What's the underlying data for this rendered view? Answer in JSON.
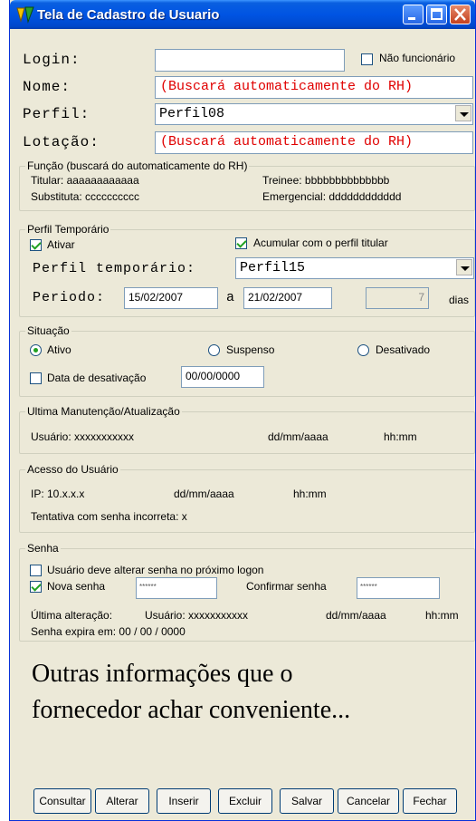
{
  "window": {
    "title": "Tela de Cadastro de Usuario",
    "icon": "app-logo-icon"
  },
  "colors": {
    "titlebar": "#0054e3",
    "face": "#ece9d8",
    "error_text": "#e00000",
    "check": "#21a121"
  },
  "header": {
    "login_label": "Login:",
    "login_value": "",
    "nao_funcionario_label": "Não funcionário",
    "nome_label": "Nome:",
    "nome_value": "(Buscará automaticamente do RH)",
    "perfil_label": "Perfil:",
    "perfil_value": "Perfil08",
    "lotacao_label": "Lotação:",
    "lotacao_value": "(Buscará automaticamente do RH)"
  },
  "funcao": {
    "legend": "Função (buscará do automaticamente do RH)",
    "titular": "Titular:  aaaaaaaaaaaa",
    "trainee": "Treinee:  bbbbbbbbbbbbbb",
    "substituta": "Substituta:  cccccccccc",
    "emergencial": "Emergencial:  dddddddddddd"
  },
  "perfil_temporario": {
    "legend": "Perfil Temporário",
    "ativar_label": "Ativar",
    "acumular_label": "Acumular com o perfil titular",
    "perfil_label": "Perfil temporário:",
    "perfil_value": "Perfil15",
    "periodo_label": "Periodo:",
    "data_inicio": "15/02/2007",
    "a_label": "a",
    "data_fim": "21/02/2007",
    "dias_value": "7",
    "dias_label": "dias"
  },
  "situacao": {
    "legend": "Situação",
    "ativo_label": "Ativo",
    "suspenso_label": "Suspenso",
    "desativado_label": "Desativado",
    "data_desativacao_label": "Data de desativação",
    "data_desativacao_value": "00/00/0000"
  },
  "manutencao": {
    "legend": "Ultima Manutenção/Atualização",
    "usuario": "Usuário:  xxxxxxxxxxx",
    "data": "dd/mm/aaaa",
    "hora": "hh:mm"
  },
  "acesso": {
    "legend": "Acesso do Usuário",
    "ip": "IP:  10.x.x.x",
    "data": "dd/mm/aaaa",
    "hora": "hh:mm",
    "tentativa": "Tentativa com senha incorreta:  x"
  },
  "senha": {
    "legend": "Senha",
    "deve_alterar_label": "Usuário deve alterar senha no próximo logon",
    "nova_senha_label": "Nova senha",
    "nova_senha_value": "******",
    "confirmar_label": "Confirmar senha",
    "confirmar_value": "******",
    "ultima_alteracao": "Última alteração:",
    "usuario": "Usuário:  xxxxxxxxxxx",
    "data": "dd/mm/aaaa",
    "hora": "hh:mm",
    "expira": "Senha expira em:   00 / 00 / 0000"
  },
  "outras_info": [
    "Outras informações que o",
    "fornecedor achar conveniente..."
  ],
  "buttons": {
    "consultar": "Consultar",
    "alterar": "Alterar",
    "inserir": "Inserir",
    "excluir": "Excluir",
    "salvar": "Salvar",
    "cancelar": "Cancelar",
    "fechar": "Fechar"
  }
}
